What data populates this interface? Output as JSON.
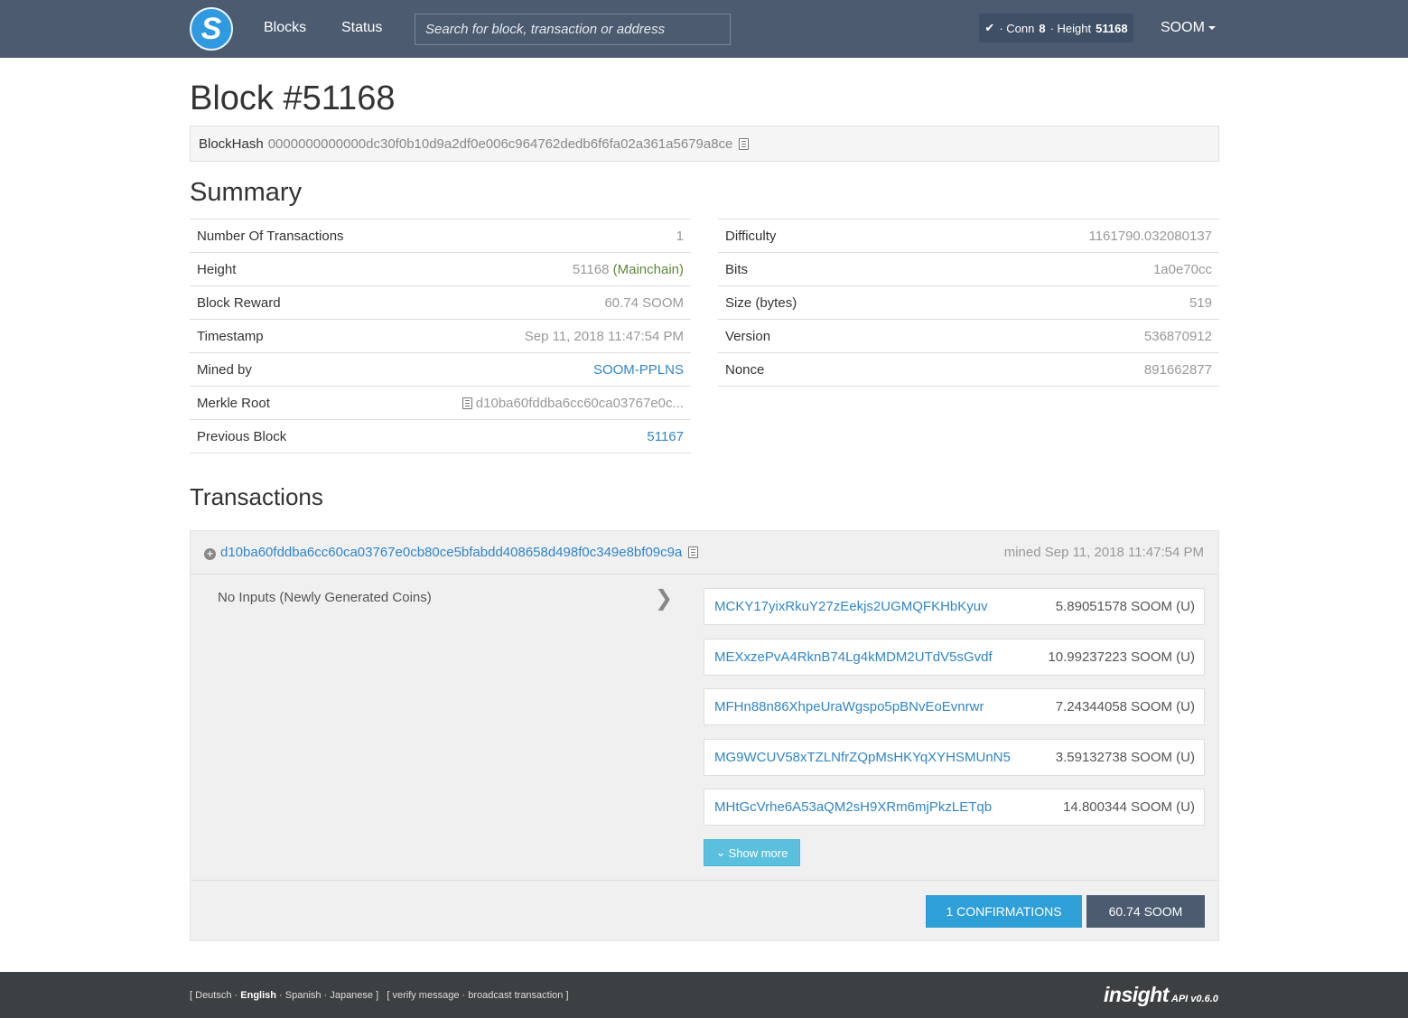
{
  "navbar": {
    "logo_letter": "S",
    "links": [
      "Blocks",
      "Status"
    ],
    "search_placeholder": "Search for block, transaction or address",
    "conn_label": "· Conn",
    "conn_count": "8",
    "height_label": "· Height",
    "height_value": "51168",
    "coin": "SOOM"
  },
  "block": {
    "title": "Block #51168",
    "hash_label": "BlockHash",
    "hash": "0000000000000dc30f0b10d9a2df0e006c964762dedb6f6fa02a361a5679a8ce"
  },
  "summary": {
    "title": "Summary",
    "left": [
      {
        "key": "Number Of Transactions",
        "value": "1"
      },
      {
        "key": "Height",
        "value": "51168",
        "extra": "(Mainchain)"
      },
      {
        "key": "Block Reward",
        "value": "60.74 SOOM"
      },
      {
        "key": "Timestamp",
        "value": "Sep 11, 2018 11:47:54 PM"
      },
      {
        "key": "Mined by",
        "value": "SOOM-PPLNS"
      },
      {
        "key": "Merkle Root",
        "value": "d10ba60fddba6cc60ca03767e0c..."
      },
      {
        "key": "Previous Block",
        "value": "51167"
      }
    ],
    "right": [
      {
        "key": "Difficulty",
        "value": "1161790.032080137"
      },
      {
        "key": "Bits",
        "value": "1a0e70cc"
      },
      {
        "key": "Size (bytes)",
        "value": "519"
      },
      {
        "key": "Version",
        "value": "536870912"
      },
      {
        "key": "Nonce",
        "value": "891662877"
      }
    ]
  },
  "transactions": {
    "title": "Transactions",
    "txid": "d10ba60fddba6cc60ca03767e0cb80ce5bfabdd408658d498f0c349e8bf09c9a",
    "mined": "mined Sep 11, 2018 11:47:54 PM",
    "no_inputs": "No Inputs (Newly Generated Coins)",
    "outputs": [
      {
        "address": "MCKY17yixRkuY27zEekjs2UGMQFKHbKyuv",
        "amount": "5.89051578 SOOM (U)"
      },
      {
        "address": "MEXxzePvA4RknB74Lg4kMDM2UTdV5sGvdf",
        "amount": "10.99237223 SOOM (U)"
      },
      {
        "address": "MFHn88n86XhpeUraWgspo5pBNvEoEvnrwr",
        "amount": "7.24344058 SOOM (U)"
      },
      {
        "address": "MG9WCUV58xTZLNfrZQpMsHKYqXYHSMUnN5",
        "amount": "3.59132738 SOOM (U)"
      },
      {
        "address": "MHtGcVrhe6A53aQM2sH9XRm6mjPkzLETqb",
        "amount": "14.800344 SOOM (U)"
      }
    ],
    "show_more": "Show more",
    "confirmations": "1 CONFIRMATIONS",
    "total": "60.74 SOOM"
  },
  "footer": {
    "lang_open": "[",
    "languages": [
      "Deutsch",
      "English",
      "Spanish",
      "Japanese"
    ],
    "lang_close": "]",
    "tools_open": "[",
    "tools": [
      "verify message",
      "broadcast transaction"
    ],
    "tools_close": "]",
    "brand": "insight",
    "api_version": "API v0.6.0"
  },
  "colors": {
    "navbar": "#4d5b70",
    "link": "#2f86c9",
    "confirm_button": "#2f9fd8",
    "show_more_button": "#5bc0de",
    "footer": "#3c4042"
  }
}
